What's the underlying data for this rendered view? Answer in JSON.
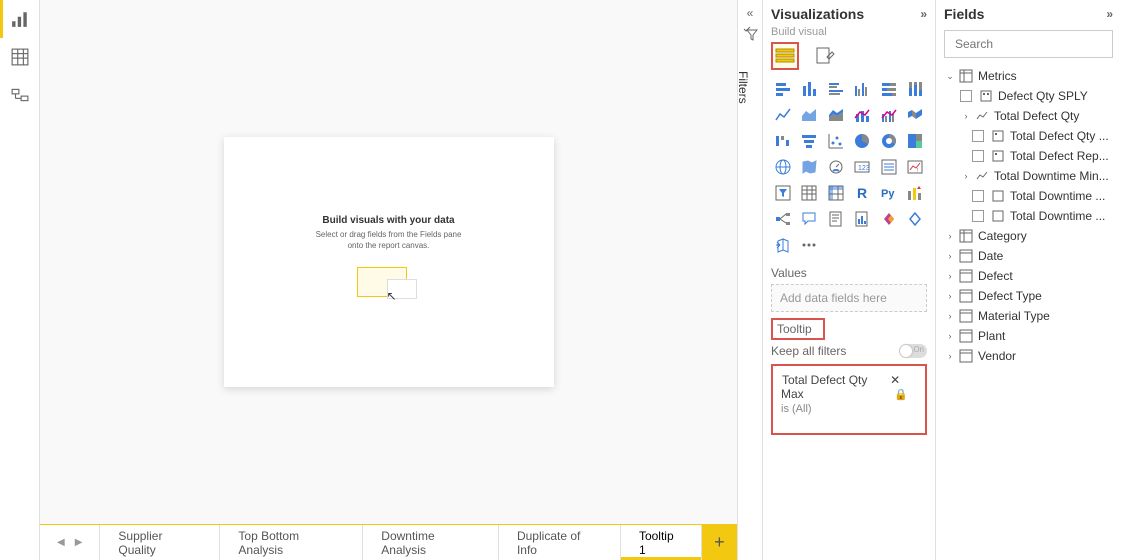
{
  "filters": {
    "label": "Filters"
  },
  "canvas": {
    "title": "Build visuals with your data",
    "subtitle": "Select or drag fields from the Fields pane onto the report canvas."
  },
  "tabs": {
    "items": [
      {
        "label": "Supplier Quality"
      },
      {
        "label": "Top Bottom Analysis"
      },
      {
        "label": "Downtime Analysis"
      },
      {
        "label": "Duplicate of Info"
      },
      {
        "label": "Tooltip 1"
      }
    ],
    "add": "+"
  },
  "vis": {
    "title": "Visualizations",
    "build": "Build visual",
    "values": "Values",
    "values_placeholder": "Add data fields here",
    "tooltip": "Tooltip",
    "keep": "Keep all filters",
    "toggle": "On",
    "filter_field": "Total Defect Qty Max",
    "filter_condition": "is (All)"
  },
  "fields": {
    "title": "Fields",
    "search_placeholder": "Search",
    "metrics": "Metrics",
    "items": {
      "defect_qty_sply": "Defect Qty SPLY",
      "total_defect_qty": "Total Defect Qty",
      "total_defect_qty_child": "Total Defect Qty ...",
      "total_defect_rep": "Total Defect Rep...",
      "total_downtime_min": "Total Downtime Min...",
      "total_downtime_1": "Total Downtime ...",
      "total_downtime_2": "Total Downtime ..."
    },
    "tables": [
      "Category",
      "Date",
      "Defect",
      "Defect Type",
      "Material Type",
      "Plant",
      "Vendor"
    ]
  }
}
